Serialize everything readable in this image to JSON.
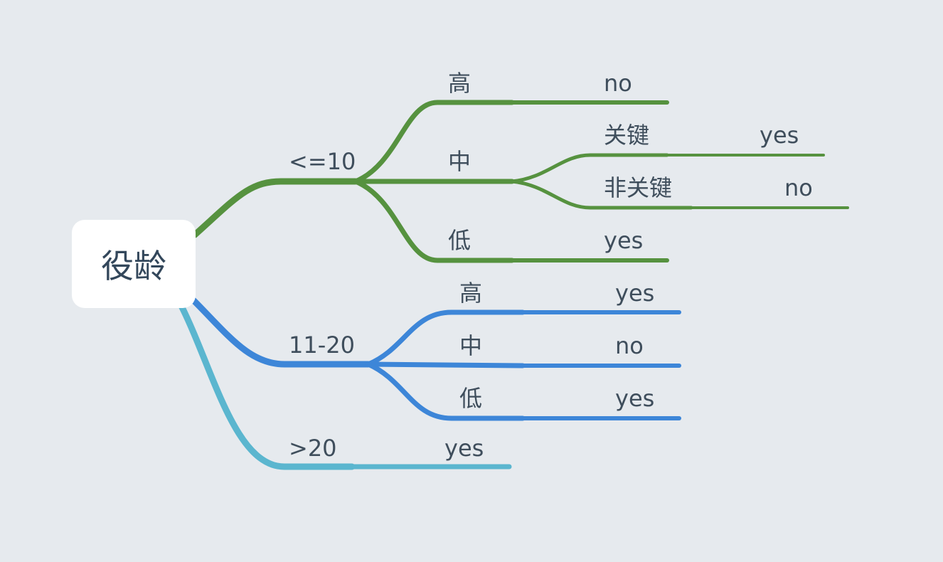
{
  "colors": {
    "background": "#e6eaee",
    "branch_green": "#56923f",
    "branch_blue": "#3d86d8",
    "branch_teal": "#5bb6cf",
    "text": "#3f4e5c"
  },
  "root": {
    "label": "役龄"
  },
  "branches": {
    "b1": {
      "label": "<=10",
      "high": {
        "label": "高",
        "result": "no"
      },
      "mid": {
        "label": "中",
        "key": {
          "label": "关键",
          "result": "yes"
        },
        "nonkey": {
          "label": "非关键",
          "result": "no"
        }
      },
      "low": {
        "label": "低",
        "result": "yes"
      }
    },
    "b2": {
      "label": "11-20",
      "high": {
        "label": "高",
        "result": "yes"
      },
      "mid": {
        "label": "中",
        "result": "no"
      },
      "low": {
        "label": "低",
        "result": "yes"
      }
    },
    "b3": {
      "label": ">20",
      "result": "yes"
    }
  }
}
